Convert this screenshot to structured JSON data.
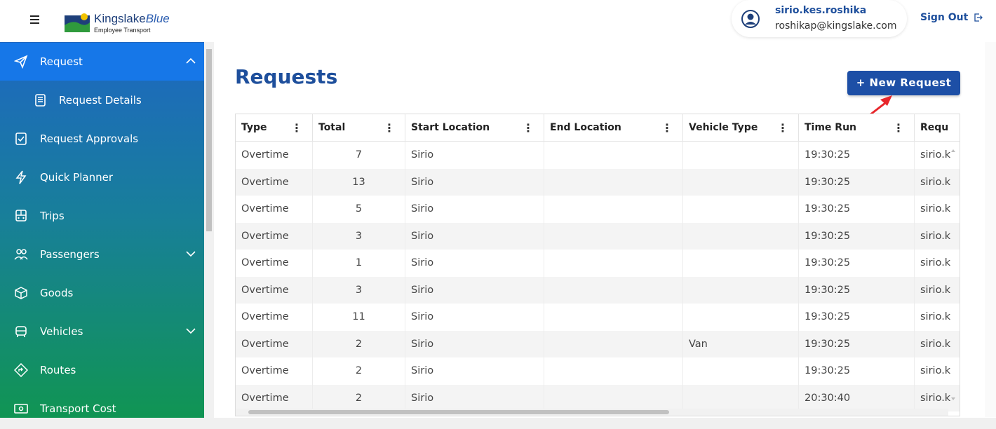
{
  "brand": {
    "name_part1": "Kingslake",
    "name_part2": "Blue",
    "subtitle": "Employee Transport"
  },
  "user": {
    "username": "sirio.kes.roshika",
    "email": "roshikap@kingslake.com"
  },
  "header": {
    "sign_out": "Sign Out"
  },
  "sidebar": {
    "items": [
      {
        "label": "Request",
        "icon": "paper-plane-icon",
        "expanded": true
      },
      {
        "label": "Request Details",
        "icon": "document-list-icon"
      },
      {
        "label": "Request Approvals",
        "icon": "check-square-icon"
      },
      {
        "label": "Quick Planner",
        "icon": "lightning-icon"
      },
      {
        "label": "Trips",
        "icon": "bus-front-icon"
      },
      {
        "label": "Passengers",
        "icon": "people-icon",
        "expanded": false
      },
      {
        "label": "Goods",
        "icon": "box-icon"
      },
      {
        "label": "Vehicles",
        "icon": "vehicle-icon",
        "expanded": false
      },
      {
        "label": "Routes",
        "icon": "route-icon"
      },
      {
        "label": "Transport Cost",
        "icon": "money-icon"
      }
    ]
  },
  "main": {
    "title": "Requests",
    "new_request_label": "+ New Request",
    "columns": [
      "Type",
      "Total",
      "Start Location",
      "End Location",
      "Vehicle Type",
      "Time Run",
      "Requ"
    ],
    "rows": [
      {
        "type": "Overtime",
        "total": "7",
        "start": "Sirio",
        "end": "",
        "vehicle": "",
        "time": "19:30:25",
        "req": "sirio.k"
      },
      {
        "type": "Overtime",
        "total": "13",
        "start": "Sirio",
        "end": "",
        "vehicle": "",
        "time": "19:30:25",
        "req": "sirio.k"
      },
      {
        "type": "Overtime",
        "total": "5",
        "start": "Sirio",
        "end": "",
        "vehicle": "",
        "time": "19:30:25",
        "req": "sirio.k"
      },
      {
        "type": "Overtime",
        "total": "3",
        "start": "Sirio",
        "end": "",
        "vehicle": "",
        "time": "19:30:25",
        "req": "sirio.k"
      },
      {
        "type": "Overtime",
        "total": "1",
        "start": "Sirio",
        "end": "",
        "vehicle": "",
        "time": "19:30:25",
        "req": "sirio.k"
      },
      {
        "type": "Overtime",
        "total": "3",
        "start": "Sirio",
        "end": "",
        "vehicle": "",
        "time": "19:30:25",
        "req": "sirio.k"
      },
      {
        "type": "Overtime",
        "total": "11",
        "start": "Sirio",
        "end": "",
        "vehicle": "",
        "time": "19:30:25",
        "req": "sirio.k"
      },
      {
        "type": "Overtime",
        "total": "2",
        "start": "Sirio",
        "end": "",
        "vehicle": "Van",
        "time": "19:30:25",
        "req": "sirio.k"
      },
      {
        "type": "Overtime",
        "total": "2",
        "start": "Sirio",
        "end": "",
        "vehicle": "",
        "time": "19:30:25",
        "req": "sirio.k"
      },
      {
        "type": "Overtime",
        "total": "2",
        "start": "Sirio",
        "end": "",
        "vehicle": "",
        "time": "20:30:40",
        "req": "sirio.k"
      }
    ]
  },
  "colors": {
    "primary": "#1d4fa6",
    "title": "#1e4f9c",
    "sidebar_top": "#1e67c2",
    "sidebar_bottom": "#10964f",
    "sidebar_active": "#1677e8",
    "annotation_arrow": "#e8262b"
  }
}
